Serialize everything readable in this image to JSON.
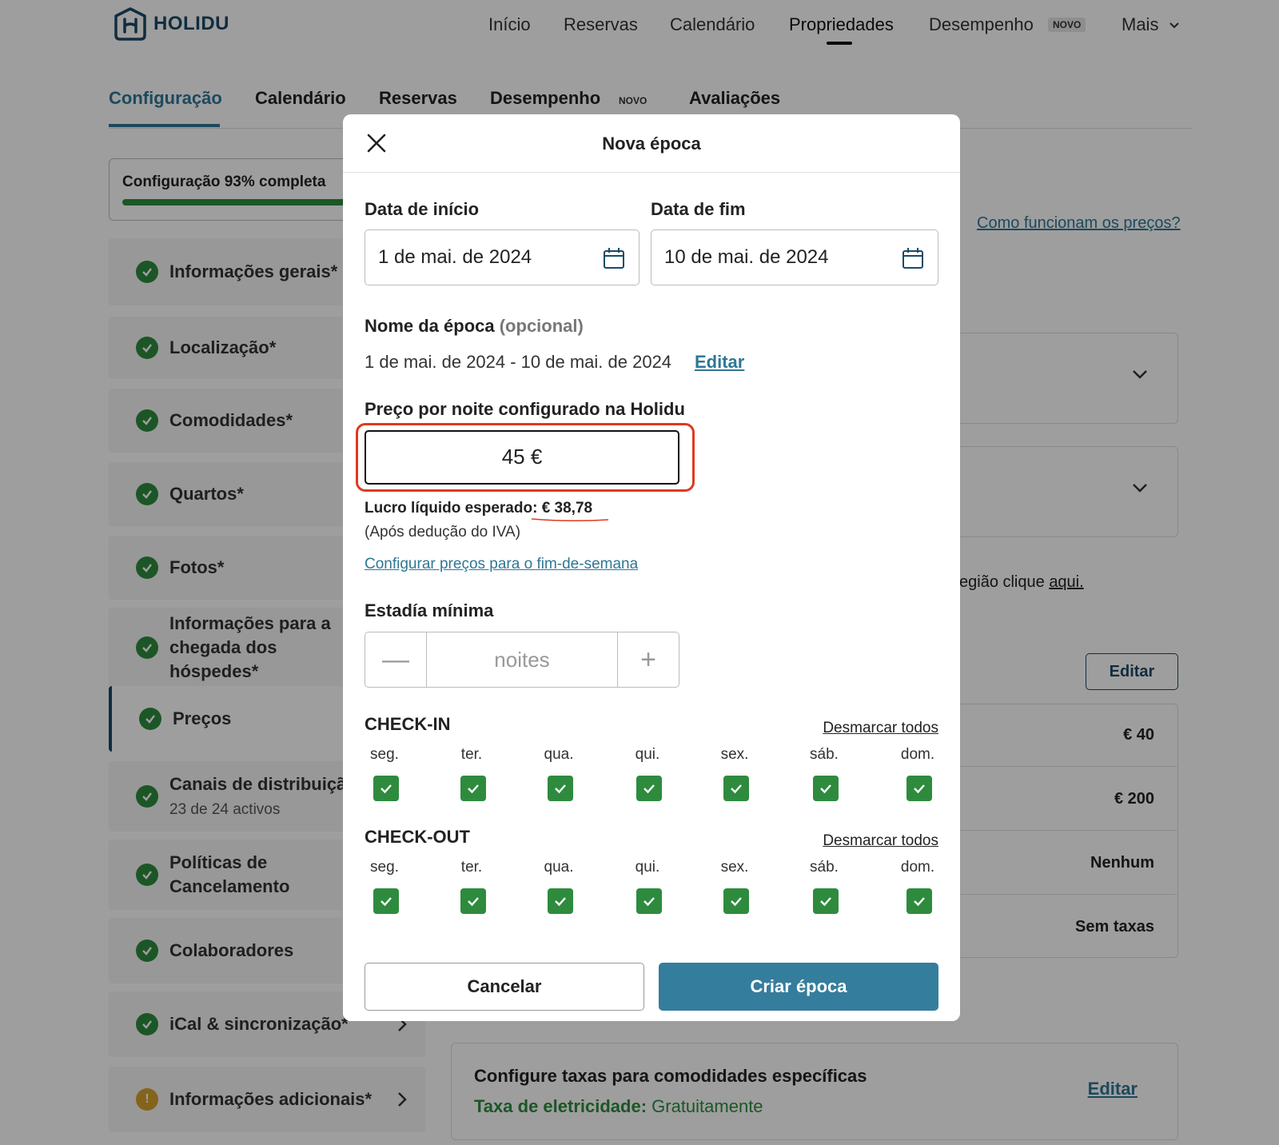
{
  "brand": {
    "name": "HOLIDU"
  },
  "topnav": {
    "items": [
      "Início",
      "Reservas",
      "Calendário",
      "Propriedades",
      "Desempenho",
      "Mais"
    ],
    "badge": "NOVO"
  },
  "subtabs": {
    "items": [
      "Configuração",
      "Calendário",
      "Reservas",
      "Desempenho",
      "Avaliações"
    ],
    "badge": "NOVO"
  },
  "sidebar": {
    "progress_text": "Configuração 93% completa",
    "progress_fraction": 0.93,
    "items": [
      {
        "label": "Informações gerais*"
      },
      {
        "label": "Localização*"
      },
      {
        "label": "Comodidades*"
      },
      {
        "label": "Quartos*"
      },
      {
        "label": "Fotos*"
      },
      {
        "label": "Informações para a chegada dos hóspedes*"
      },
      {
        "label": "Preços"
      },
      {
        "label": "Canais de distribuição",
        "sub": "23 de 24 activos"
      },
      {
        "label": "Políticas de Cancelamento"
      },
      {
        "label": "Colaboradores"
      },
      {
        "label": "iCal & sincronização*"
      },
      {
        "label": "Informações adicionais*"
      }
    ],
    "warn_symbol": "!"
  },
  "main": {
    "prices_help_link": "Como funcionam os preços?",
    "region_text": "egião clique ",
    "region_link": "aqui.",
    "edit_button": "Editar",
    "values": [
      "€ 40",
      "€ 200",
      "Nenhum",
      "Sem taxas"
    ],
    "fees_card": {
      "title": "Configure taxas para comodidades específicas",
      "sub_label": "Taxa de eletricidade:",
      "sub_value": "Gratuitamente",
      "edit": "Editar"
    }
  },
  "modal": {
    "title": "Nova época",
    "start_label": "Data de início",
    "start_value": "1 de mai. de 2024",
    "end_label": "Data de fim",
    "end_value": "10 de mai. de 2024",
    "name_label": "Nome da época",
    "name_optional": "(opcional)",
    "name_value": "1 de mai. de 2024 - 10 de mai. de 2024",
    "name_edit": "Editar",
    "price_label": "Preço por noite configurado na Holidu",
    "price_value": "45 €",
    "profit_label": "Lucro líquido esperado:",
    "profit_value": "€ 38,78",
    "vat_note": "(Após dedução do IVA)",
    "weekend_link": "Configurar preços para o fim-de-semana",
    "min_stay_label": "Estadía mínima",
    "min_stay_placeholder": "noites",
    "minus": "—",
    "plus": "+",
    "checkin": {
      "title": "CHECK-IN",
      "uncheck_all": "Desmarcar todos",
      "days": [
        "seg.",
        "ter.",
        "qua.",
        "qui.",
        "sex.",
        "sáb.",
        "dom."
      ]
    },
    "checkout": {
      "title": "CHECK-OUT",
      "uncheck_all": "Desmarcar todos",
      "days": [
        "seg.",
        "ter.",
        "qua.",
        "qui.",
        "sex.",
        "sáb.",
        "dom."
      ]
    },
    "cancel": "Cancelar",
    "create": "Criar época"
  },
  "colors": {
    "accent": "#2f7796",
    "primary_button": "#357d9c",
    "check_green": "#2e8b3e",
    "highlight_red": "#e0391f"
  }
}
